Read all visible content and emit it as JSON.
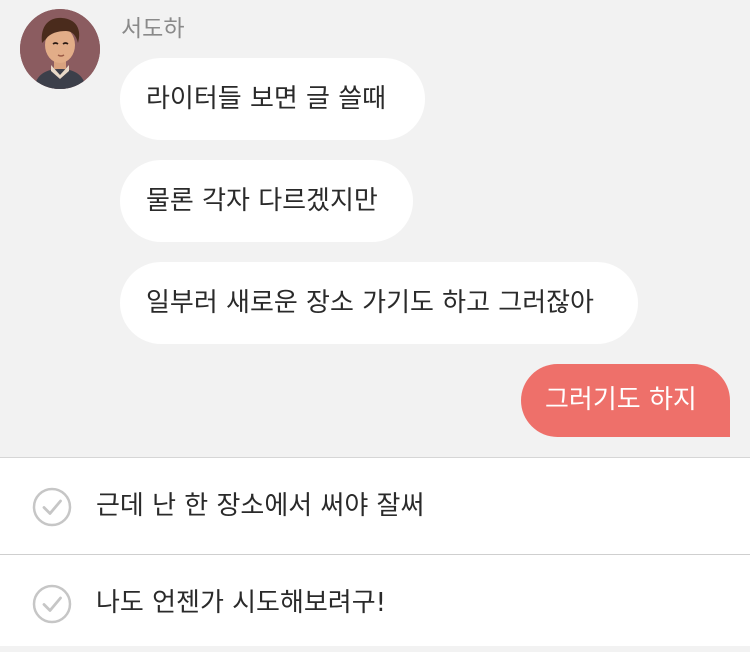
{
  "chat": {
    "sender_name": "서도하",
    "incoming_messages": [
      {
        "text": "라이터들 보면 글 쓸때"
      },
      {
        "text": "물론 각자 다르겠지만"
      },
      {
        "text": "일부러 새로운 장소 가기도 하고 그러잖아"
      }
    ],
    "outgoing_message": {
      "text": "그러기도 하지"
    }
  },
  "reply_options": [
    {
      "label": "근데 난 한 장소에서 써야 잘써",
      "icon": "check-circle-icon"
    },
    {
      "label": "나도 언젠가 시도해보려구!",
      "icon": "check-circle-icon"
    }
  ],
  "colors": {
    "chat_background": "#f2f2f2",
    "incoming_bubble": "#ffffff",
    "outgoing_bubble": "#ee706a",
    "options_background": "#ffffff"
  }
}
